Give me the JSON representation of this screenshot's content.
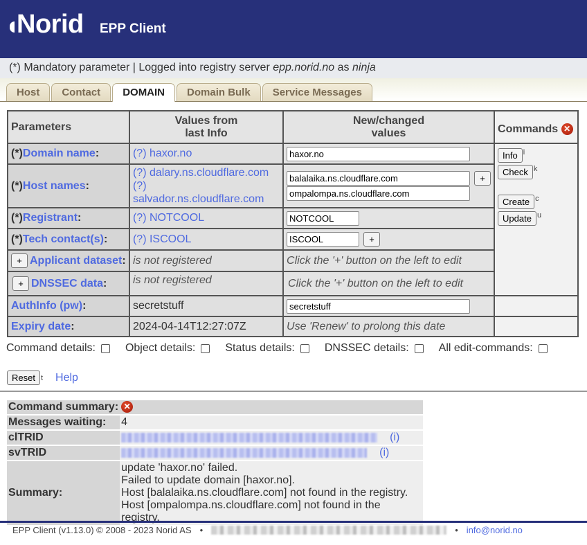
{
  "header": {
    "logo_text": "Norid",
    "app_title": "EPP Client",
    "brand_color": "#27307a"
  },
  "status": {
    "mandatory": "(*) Mandatory parameter",
    "logged_prefix": "| Logged into registry server",
    "server": "epp.norid.no",
    "as_word": "as",
    "user": "ninja"
  },
  "tabs": [
    {
      "label": "Host",
      "active": false
    },
    {
      "label": "Contact",
      "active": false
    },
    {
      "label": "DOMAIN",
      "active": true
    },
    {
      "label": "Domain Bulk",
      "active": false
    },
    {
      "label": "Service Messages",
      "active": false
    }
  ],
  "table": {
    "headers": {
      "parameters": "Parameters",
      "prev_line1": "Values from",
      "prev_line2": "last Info",
      "new_line1": "New/changed",
      "new_line2": "values",
      "commands": "Commands"
    },
    "mandatory_marker": "(*)",
    "rows": {
      "domain": {
        "label": "Domain name",
        "prev": "(?) haxor.no",
        "value": "haxor.no"
      },
      "hosts": {
        "label": "Host names",
        "prev": [
          "(?) dalary.ns.cloudflare.com",
          "(?) salvador.ns.cloudflare.com"
        ],
        "values": [
          "balalaika.ns.cloudflare.com",
          "ompalompa.ns.cloudflare.com"
        ]
      },
      "registrant": {
        "label": "Registrant",
        "prev": "(?) NOTCOOL",
        "value": "NOTCOOL"
      },
      "tech": {
        "label": "Tech contact(s)",
        "prev": "(?) ISCOOL",
        "value": "ISCOOL"
      },
      "applicant": {
        "label": "Applicant dataset",
        "prev": "is not registered",
        "note": "Click the '+' button on the left to edit"
      },
      "dnssec": {
        "label": "DNSSEC data",
        "prev": "is not registered",
        "note": "Click the '+' button on the left to edit"
      },
      "authinfo": {
        "label": "AuthInfo (pw)",
        "prev": "secretstuff",
        "value": "secretstuff"
      },
      "expiry": {
        "label": "Expiry date",
        "prev": "2024-04-14T12:27:07Z",
        "note": "Use 'Renew' to prolong this date"
      }
    },
    "colon": ":",
    "plus": "+",
    "commands": [
      {
        "label": "Info",
        "key": "i"
      },
      {
        "label": "Check",
        "key": "k"
      },
      {
        "label": "Create",
        "key": "c"
      },
      {
        "label": "Update",
        "key": "u"
      }
    ]
  },
  "options": [
    {
      "label": "Command details:",
      "checked": false
    },
    {
      "label": "Object details:",
      "checked": false
    },
    {
      "label": "Status details:",
      "checked": false
    },
    {
      "label": "DNSSEC details:",
      "checked": false
    },
    {
      "label": "All edit-commands:",
      "checked": false
    }
  ],
  "reset": {
    "label": "Reset",
    "key": "t"
  },
  "help_label": "Help",
  "summary": {
    "title": "Command summary:",
    "messages_label": "Messages waiting:",
    "messages_value": "4",
    "cltrid_label": "clTRID",
    "svtrid_label": "svTRID",
    "info_link": "(i)",
    "summary_label": "Summary:",
    "lines": [
      "update 'haxor.no' failed.",
      "Failed to update domain [haxor.no].",
      "Host [balalaika.ns.cloudflare.com] not found in the registry.",
      "Host [ompalompa.ns.cloudflare.com] not found in the registry."
    ]
  },
  "footer": {
    "copyright": "EPP Client (v1.13.0) © 2008 - 2023 Norid AS",
    "bullet": "•",
    "email": "info@norid.no"
  }
}
